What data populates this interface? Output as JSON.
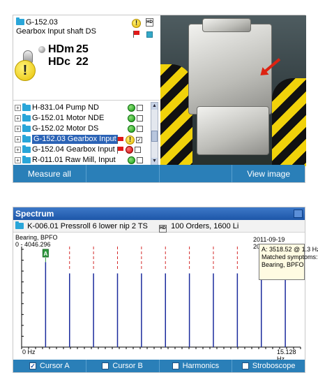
{
  "machine_view": {
    "asset_id": "G-152.03",
    "asset_name": "Gearbox Input shaft DS",
    "hdm_label": "HDm",
    "hdm_value": "25",
    "hdc_label": "HDc",
    "hdc_value": "22",
    "warn_glyph": "!",
    "doc_glyph": "HD",
    "tree": [
      {
        "label": "H-831.04 Pump ND",
        "status": "green",
        "checked": false,
        "selected": false
      },
      {
        "label": "G-152.01 Motor  NDE",
        "status": "green",
        "checked": false,
        "selected": false
      },
      {
        "label": "G-152.02 Motor  DS",
        "status": "green",
        "checked": false,
        "selected": false
      },
      {
        "label": "G-152.03 Gearbox Input",
        "status": "warning",
        "checked": true,
        "selected": true
      },
      {
        "label": "G-152.04 Gearbox Input",
        "status": "red",
        "checked": false,
        "selected": false
      },
      {
        "label": "R-011.01 Raw Mill, Input",
        "status": "green",
        "checked": false,
        "selected": false
      }
    ],
    "toolbar": {
      "measure_all": "Measure all",
      "view_image": "View image"
    }
  },
  "spectrum": {
    "window_title": "Spectrum",
    "measurement_point": "K-006.01 Pressroll 6 lower nip 2 TS",
    "measurement_spec": "100 Orders, 1600 Li",
    "symptom_label": "Bearing, BPFO",
    "range_label": "0  -  4046.296",
    "timestamp": "2011-09-19 20:49:44",
    "cursor_marker": "A",
    "x_start": "0 Hz",
    "x_end": "15.128 Hz",
    "tooltip": {
      "line1": "A: 3518.52  @ 1.3 Hz",
      "line2": "Matched symptoms:",
      "line3": "Bearing, BPFO"
    },
    "bottom_bar": {
      "cursor_a": "Cursor A",
      "cursor_b": "Cursor B",
      "harmonics": "Harmonics",
      "stroboscope": "Stroboscope"
    },
    "check_glyph": "✓"
  },
  "chart_data": {
    "type": "bar",
    "title": "Spectrum",
    "x_range": [
      0,
      15.128
    ],
    "y_range": [
      0,
      4046.296
    ],
    "xlabel": "",
    "ylabel": "",
    "x_unit": "Hz",
    "peaks_x": [
      1.3,
      2.6,
      3.9,
      5.2,
      6.5,
      7.8,
      9.1,
      10.4,
      11.7,
      13.0,
      14.3
    ],
    "peaks_y": [
      3518.52,
      3050,
      3050,
      3050,
      3050,
      3050,
      3050,
      3050,
      3050,
      3050,
      3050
    ],
    "harmonic_markers_x": [
      2.6,
      3.9,
      5.2,
      6.5,
      7.8,
      9.1,
      10.4,
      11.7,
      13.0,
      14.3
    ],
    "cursor_a_x": 1.3,
    "colors": {
      "peaks": "#1a2a9c",
      "harmonic_markers": "#d42a2a",
      "cursor": "#2e9a3e"
    }
  }
}
